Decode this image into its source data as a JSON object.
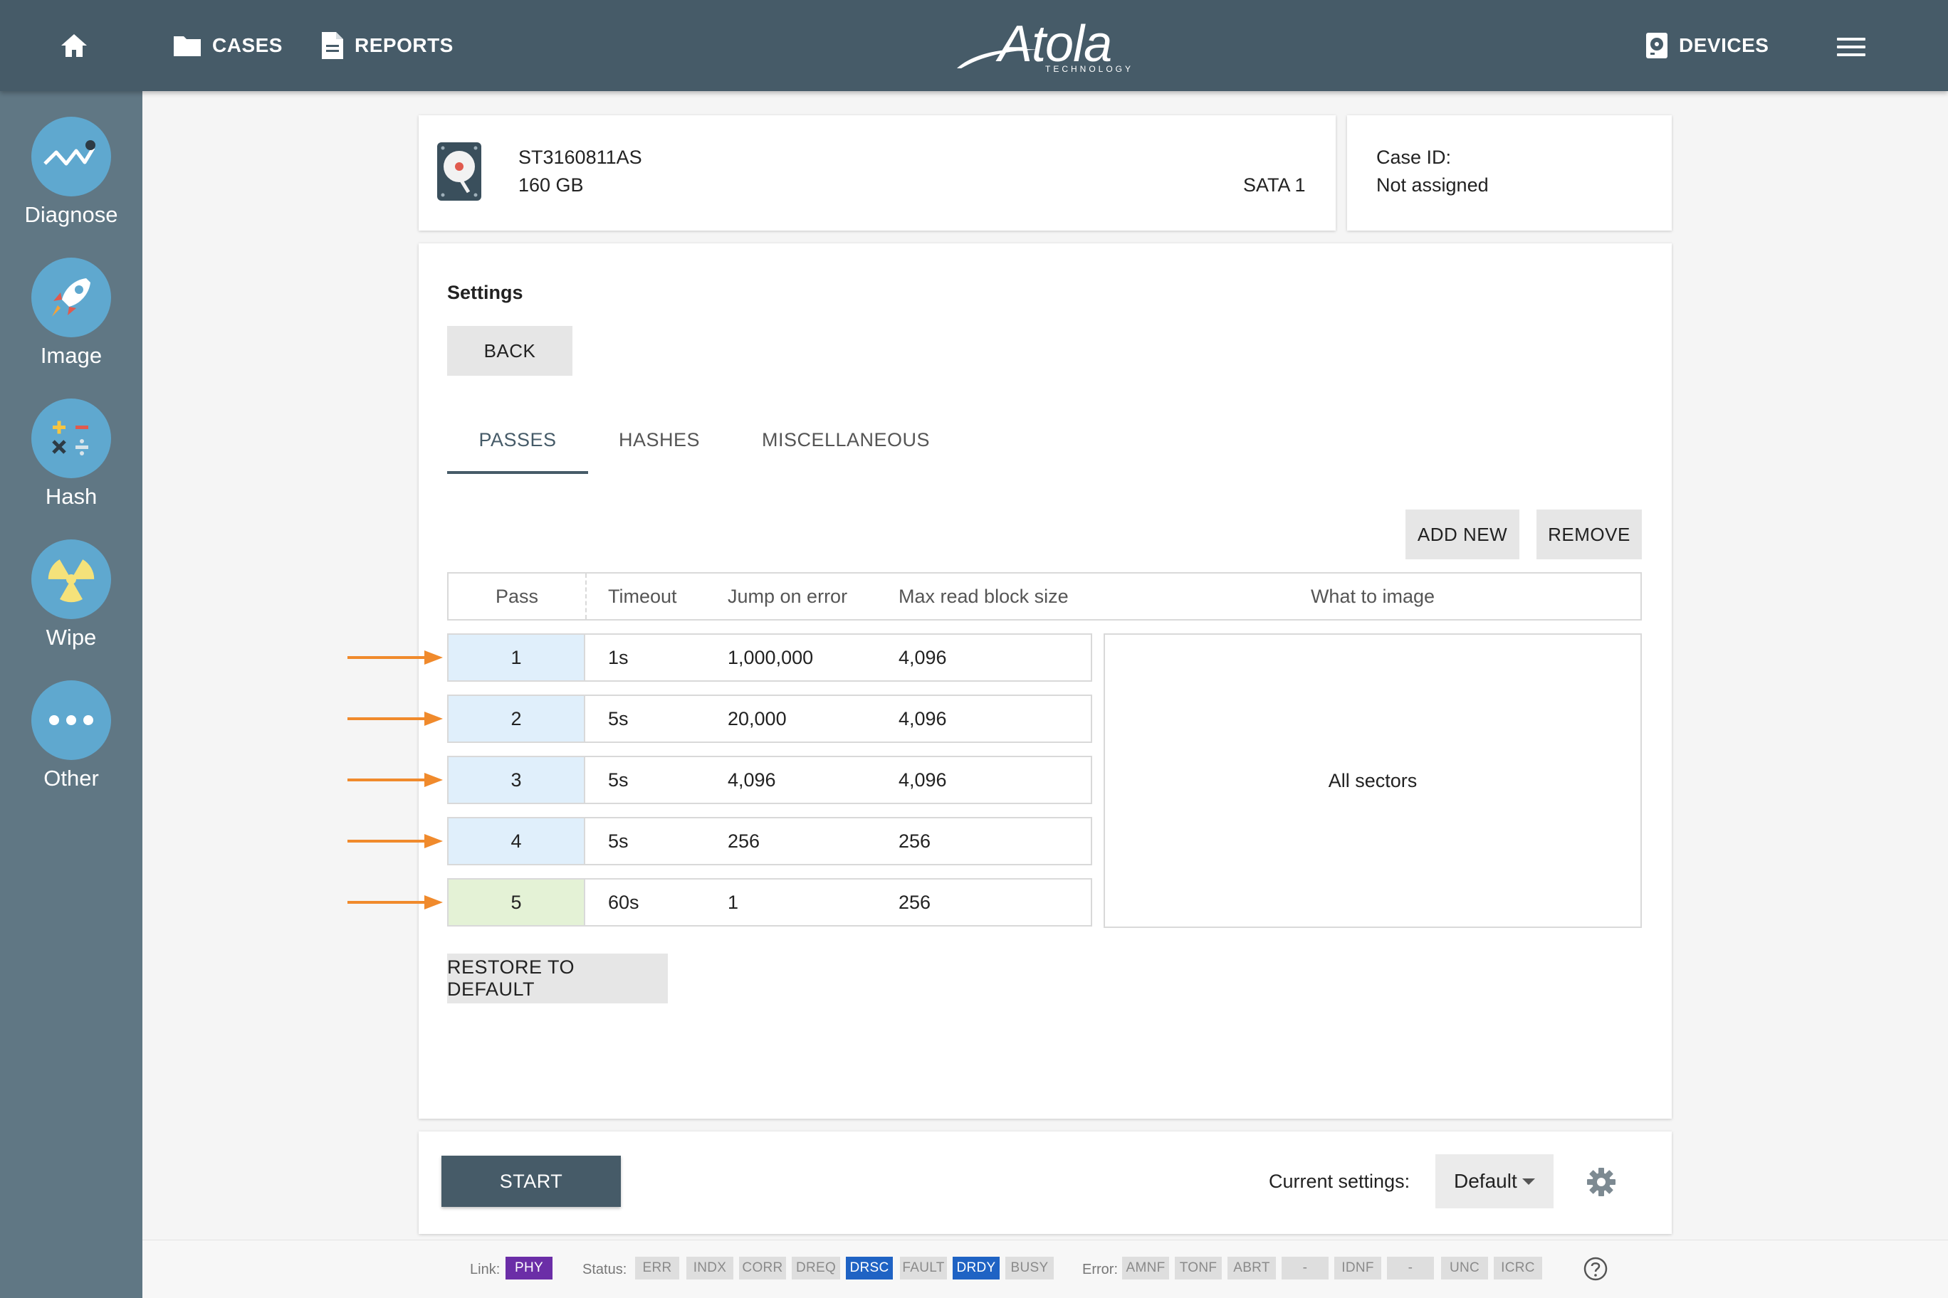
{
  "topbar": {
    "cases_label": "CASES",
    "reports_label": "REPORTS",
    "logo_text": "Atola",
    "logo_subtitle": "TECHNOLOGY",
    "devices_label": "DEVICES"
  },
  "sidebar": {
    "items": [
      {
        "label": "Diagnose",
        "icon": "diagnose-icon"
      },
      {
        "label": "Image",
        "icon": "rocket-icon"
      },
      {
        "label": "Hash",
        "icon": "calculator-icon"
      },
      {
        "label": "Wipe",
        "icon": "radiation-icon"
      },
      {
        "label": "Other",
        "icon": "more-icon"
      }
    ]
  },
  "device": {
    "model": "ST3160811AS",
    "capacity": "160 GB",
    "interface": "SATA 1"
  },
  "case": {
    "label": "Case ID:",
    "value": "Not assigned"
  },
  "settings": {
    "title": "Settings",
    "back_label": "BACK",
    "tabs": [
      {
        "label": "PASSES",
        "active": true
      },
      {
        "label": "HASHES",
        "active": false
      },
      {
        "label": "MISCELLANEOUS",
        "active": false
      }
    ],
    "add_new_label": "ADD NEW",
    "remove_label": "REMOVE",
    "table": {
      "headers": [
        "Pass",
        "Timeout",
        "Jump on error",
        "Max read block size",
        "What to image"
      ],
      "rows": [
        {
          "pass": "1",
          "timeout": "1s",
          "jump": "1,000,000",
          "block": "4,096"
        },
        {
          "pass": "2",
          "timeout": "5s",
          "jump": "20,000",
          "block": "4,096"
        },
        {
          "pass": "3",
          "timeout": "5s",
          "jump": "4,096",
          "block": "4,096"
        },
        {
          "pass": "4",
          "timeout": "5s",
          "jump": "256",
          "block": "256"
        },
        {
          "pass": "5",
          "timeout": "60s",
          "jump": "1",
          "block": "256"
        }
      ],
      "what_to_image": "All sectors"
    },
    "restore_label": "RESTORE TO DEFAULT"
  },
  "bottom": {
    "start_label": "START",
    "current_settings_label": "Current settings:",
    "current_settings_value": "Default"
  },
  "statusbar": {
    "link_label": "Link:",
    "link_badges": [
      {
        "text": "PHY",
        "state": "purple"
      }
    ],
    "status_label": "Status:",
    "status_badges": [
      {
        "text": "ERR",
        "state": "off"
      },
      {
        "text": "INDX",
        "state": "off"
      },
      {
        "text": "CORR",
        "state": "off"
      },
      {
        "text": "DREQ",
        "state": "off"
      },
      {
        "text": "DRSC",
        "state": "blue"
      },
      {
        "text": "FAULT",
        "state": "off"
      },
      {
        "text": "DRDY",
        "state": "blue"
      },
      {
        "text": "BUSY",
        "state": "off"
      }
    ],
    "error_label": "Error:",
    "error_badges": [
      {
        "text": "AMNF",
        "state": "off"
      },
      {
        "text": "TONF",
        "state": "off"
      },
      {
        "text": "ABRT",
        "state": "off"
      },
      {
        "text": "-",
        "state": "off"
      },
      {
        "text": "IDNF",
        "state": "off"
      },
      {
        "text": "-",
        "state": "off"
      },
      {
        "text": "UNC",
        "state": "off"
      },
      {
        "text": "ICRC",
        "state": "off"
      }
    ]
  },
  "colors": {
    "topbar": "#465b68",
    "sidebar": "#607784",
    "sidebar_icon_bg": "#5fa8cf",
    "pass_highlight": "#e0effb",
    "pass_last_highlight": "#e4f2d6",
    "arrow": "#f08a2c",
    "badge_purple": "#6b2ea7",
    "badge_blue": "#1f63c4"
  }
}
